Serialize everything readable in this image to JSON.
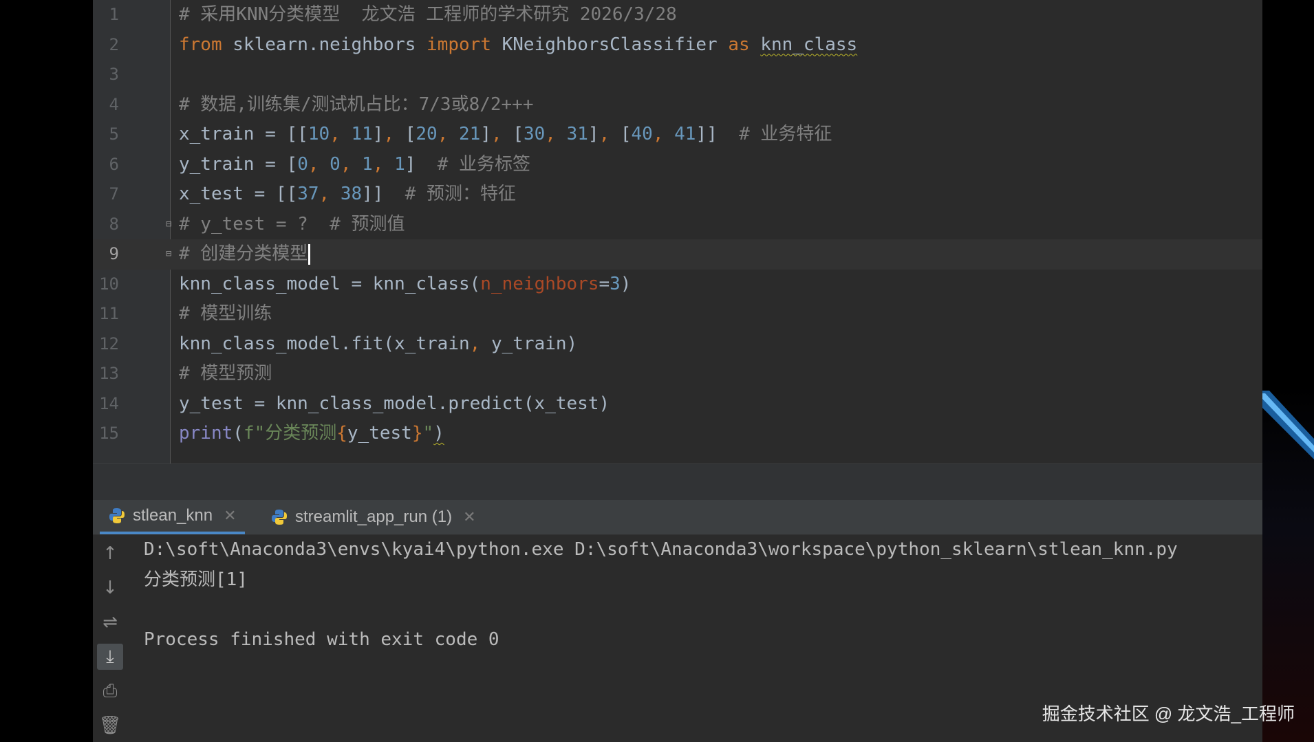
{
  "editor": {
    "current_line": 9,
    "lines": [
      {
        "n": "1",
        "tokens": [
          {
            "t": "# 采用KNN分类模型  龙文浩 工程师的学术研究 2026/3/28",
            "c": "tok-cm"
          }
        ]
      },
      {
        "n": "2",
        "tokens": [
          {
            "t": "from",
            "c": "tok-kw"
          },
          {
            "t": " sklearn.neighbors ",
            "c": ""
          },
          {
            "t": "import",
            "c": "tok-kw"
          },
          {
            "t": " KNeighborsClassifier ",
            "c": ""
          },
          {
            "t": "as",
            "c": "tok-kw"
          },
          {
            "t": " ",
            "c": ""
          },
          {
            "t": "knn_class",
            "c": "tok-wavy"
          }
        ]
      },
      {
        "n": "3",
        "tokens": []
      },
      {
        "n": "4",
        "tokens": [
          {
            "t": "# 数据,训练集/测试机占比：7/3或8/2+++",
            "c": "tok-cm"
          }
        ]
      },
      {
        "n": "5",
        "tokens": [
          {
            "t": "x_train = [[",
            "c": ""
          },
          {
            "t": "10",
            "c": "tok-num"
          },
          {
            "t": ", ",
            "c": "tok-comma"
          },
          {
            "t": "11",
            "c": "tok-num"
          },
          {
            "t": "]",
            "c": ""
          },
          {
            "t": ", ",
            "c": "tok-comma"
          },
          {
            "t": "[",
            "c": ""
          },
          {
            "t": "20",
            "c": "tok-num"
          },
          {
            "t": ", ",
            "c": "tok-comma"
          },
          {
            "t": "21",
            "c": "tok-num"
          },
          {
            "t": "]",
            "c": ""
          },
          {
            "t": ", ",
            "c": "tok-comma"
          },
          {
            "t": "[",
            "c": ""
          },
          {
            "t": "30",
            "c": "tok-num"
          },
          {
            "t": ", ",
            "c": "tok-comma"
          },
          {
            "t": "31",
            "c": "tok-num"
          },
          {
            "t": "]",
            "c": ""
          },
          {
            "t": ", ",
            "c": "tok-comma"
          },
          {
            "t": "[",
            "c": ""
          },
          {
            "t": "40",
            "c": "tok-num"
          },
          {
            "t": ", ",
            "c": "tok-comma"
          },
          {
            "t": "41",
            "c": "tok-num"
          },
          {
            "t": "]]  ",
            "c": ""
          },
          {
            "t": "# 业务特征",
            "c": "tok-cm"
          }
        ]
      },
      {
        "n": "6",
        "tokens": [
          {
            "t": "y_train = [",
            "c": ""
          },
          {
            "t": "0",
            "c": "tok-num"
          },
          {
            "t": ", ",
            "c": "tok-comma"
          },
          {
            "t": "0",
            "c": "tok-num"
          },
          {
            "t": ", ",
            "c": "tok-comma"
          },
          {
            "t": "1",
            "c": "tok-num"
          },
          {
            "t": ", ",
            "c": "tok-comma"
          },
          {
            "t": "1",
            "c": "tok-num"
          },
          {
            "t": "]  ",
            "c": ""
          },
          {
            "t": "# 业务标签",
            "c": "tok-cm"
          }
        ]
      },
      {
        "n": "7",
        "tokens": [
          {
            "t": "x_test = [[",
            "c": ""
          },
          {
            "t": "37",
            "c": "tok-num"
          },
          {
            "t": ", ",
            "c": "tok-comma"
          },
          {
            "t": "38",
            "c": "tok-num"
          },
          {
            "t": "]]  ",
            "c": ""
          },
          {
            "t": "# 预测：特征",
            "c": "tok-cm"
          }
        ]
      },
      {
        "n": "8",
        "fold": true,
        "tokens": [
          {
            "t": "# y_test = ?  # 预测值",
            "c": "tok-cm"
          }
        ]
      },
      {
        "n": "9",
        "fold": true,
        "caret": true,
        "tokens": [
          {
            "t": "# 创建分类模型",
            "c": "tok-cm"
          }
        ]
      },
      {
        "n": "10",
        "tokens": [
          {
            "t": "knn_class_model = knn_class(",
            "c": ""
          },
          {
            "t": "n_neighbors",
            "c": "tok-param"
          },
          {
            "t": "=",
            "c": ""
          },
          {
            "t": "3",
            "c": "tok-num"
          },
          {
            "t": ")",
            "c": ""
          }
        ]
      },
      {
        "n": "11",
        "tokens": [
          {
            "t": "# 模型训练",
            "c": "tok-cm"
          }
        ]
      },
      {
        "n": "12",
        "tokens": [
          {
            "t": "knn_class_model.fit(x_train",
            "c": ""
          },
          {
            "t": ", ",
            "c": "tok-comma"
          },
          {
            "t": "y_train)",
            "c": ""
          }
        ]
      },
      {
        "n": "13",
        "tokens": [
          {
            "t": "# 模型预测",
            "c": "tok-cm"
          }
        ]
      },
      {
        "n": "14",
        "tokens": [
          {
            "t": "y_test = knn_class_model.predict(x_test)",
            "c": ""
          }
        ]
      },
      {
        "n": "15",
        "tokens": [
          {
            "t": "print",
            "c": "tok-builtin"
          },
          {
            "t": "(",
            "c": ""
          },
          {
            "t": "f\"分类预测",
            "c": "tok-str"
          },
          {
            "t": "{",
            "c": "tok-brace"
          },
          {
            "t": "y_test",
            "c": ""
          },
          {
            "t": "}",
            "c": "tok-brace"
          },
          {
            "t": "\"",
            "c": "tok-str"
          },
          {
            "t": ")",
            "c": "tok-wavy"
          }
        ]
      }
    ]
  },
  "run_panel": {
    "tabs": [
      {
        "label": "stlean_knn",
        "selected": true,
        "icon": "python-icon"
      },
      {
        "label": "streamlit_app_run (1)",
        "selected": false,
        "icon": "python-icon"
      }
    ],
    "toolbar": [
      {
        "name": "up-arrow-icon",
        "glyph": "↑"
      },
      {
        "name": "down-arrow-icon",
        "glyph": "↓"
      },
      {
        "name": "soft-wrap-icon",
        "glyph": "⇌"
      },
      {
        "name": "scroll-to-end-icon",
        "glyph": "⤓",
        "active": true
      },
      {
        "name": "print-icon",
        "glyph": "⎙"
      },
      {
        "name": "trash-icon",
        "glyph": "🗑"
      }
    ],
    "console_lines": [
      "D:\\soft\\Anaconda3\\envs\\kyai4\\python.exe D:\\soft\\Anaconda3\\workspace\\python_sklearn\\stlean_knn.py",
      "分类预测[1]",
      "",
      "Process finished with exit code 0"
    ]
  },
  "watermark": "掘金技术社区 @ 龙文浩_工程师",
  "colors": {
    "editor_bg": "#2b2b2b",
    "keyword": "#cc7832",
    "number": "#6897bb",
    "comment": "#808080",
    "param": "#aa4926",
    "builtin": "#8888c6",
    "string": "#6a8759",
    "tab_underline": "#4a88c7"
  }
}
